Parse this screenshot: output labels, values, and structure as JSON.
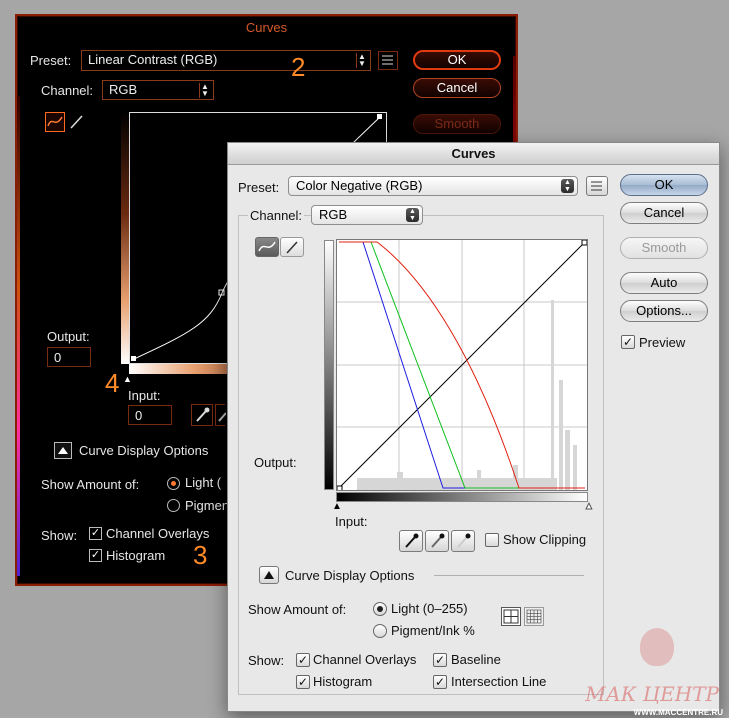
{
  "dark_dialog": {
    "title": "Curves",
    "preset_label": "Preset:",
    "preset_value": "Linear Contrast (RGB)",
    "channel_label": "Channel:",
    "channel_value": "RGB",
    "ok_label": "OK",
    "cancel_label": "Cancel",
    "smooth_label": "Smooth",
    "output_label": "Output:",
    "output_value": "0",
    "input_label": "Input:",
    "input_value": "0",
    "curve_display_options": "Curve Display Options",
    "show_amount_label": "Show Amount of:",
    "light_label": "Light (",
    "pigment_label": "Pigmen",
    "show_label": "Show:",
    "channel_overlays": "Channel Overlays",
    "histogram": "Histogram",
    "callouts": [
      "2",
      "4",
      "3"
    ],
    "accent_color": "#ff8a28",
    "border_color": "#8a1d06"
  },
  "light_dialog": {
    "title": "Curves",
    "preset_label": "Preset:",
    "preset_value": "Color Negative (RGB)",
    "channel_label": "Channel:",
    "channel_value": "RGB",
    "ok_label": "OK",
    "cancel_label": "Cancel",
    "smooth_label": "Smooth",
    "auto_label": "Auto",
    "options_label": "Options...",
    "preview_label": "Preview",
    "preview_checked": true,
    "output_label": "Output:",
    "input_label": "Input:",
    "show_clipping_label": "Show Clipping",
    "show_clipping_checked": false,
    "curve_display_options": "Curve Display Options",
    "show_amount_label": "Show Amount of:",
    "light_option": "Light  (0–255)",
    "pigment_option": "Pigment/Ink %",
    "light_selected": true,
    "show_label": "Show:",
    "channel_overlays": "Channel Overlays",
    "baseline": "Baseline",
    "histogram": "Histogram",
    "intersection_line": "Intersection Line",
    "ok_color": "#a8bcd4"
  },
  "watermark": {
    "name": "МАК ЦЕНТР",
    "url": "WWW.MACCENTRE.RU"
  }
}
